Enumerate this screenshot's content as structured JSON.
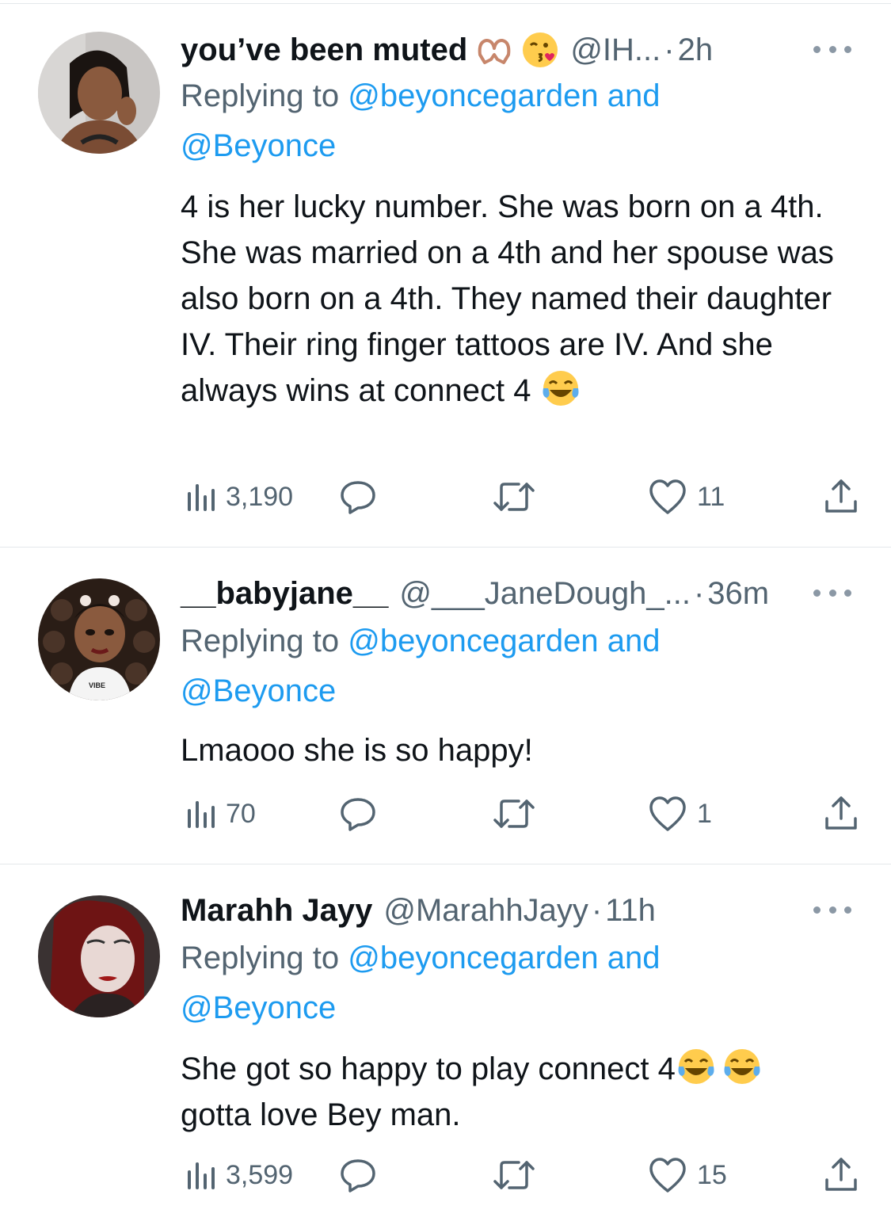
{
  "tweets": [
    {
      "name": "you’ve been muted",
      "name_emojis": [
        "heart-hands",
        "kissing-face"
      ],
      "handle": "@IH...",
      "dot": "·",
      "time": "2h",
      "reply_prefix": "Replying to",
      "reply_mention_1": "@beyoncegarden",
      "reply_and": "and",
      "reply_mention_2": "@Beyonce",
      "text": "4 is her lucky number. She was born on a 4th. She was married on a 4th and her spouse was also born on a 4th. They named their daughter IV. Their ring finger tattoos are IV. And she always wins at connect 4",
      "text_emoji": "tears-of-joy",
      "views": "3,190",
      "replies": "",
      "retweets": "",
      "likes": "11"
    },
    {
      "name": "__babyjane__",
      "handle": "@___JaneDough_...",
      "dot": "·",
      "time": "36m",
      "reply_prefix": "Replying to",
      "reply_mention_1": "@beyoncegarden",
      "reply_and": "and",
      "reply_mention_2": "@Beyonce",
      "text": "Lmaooo she is so happy!",
      "views": "70",
      "replies": "",
      "retweets": "",
      "likes": "1"
    },
    {
      "name": "Marahh Jayy",
      "handle": "@MarahhJayy",
      "dot": "·",
      "time": "11h",
      "reply_prefix": "Replying to",
      "reply_mention_1": "@beyoncegarden",
      "reply_and": "and",
      "reply_mention_2": "@Beyonce",
      "text_line1": "She got so happy to play connect 4",
      "text_line2": "gotta love Bey man.",
      "text_emojis": [
        "tears-of-joy",
        "tears-of-joy"
      ],
      "views": "3,599",
      "replies": "",
      "retweets": "",
      "likes": "15"
    }
  ],
  "colors": {
    "text": "#0f1419",
    "secondary": "#536471",
    "link": "#1d9bf0",
    "divider": "#e4e8eb"
  },
  "icons": [
    "views-icon",
    "reply-icon",
    "retweet-icon",
    "like-icon",
    "share-icon",
    "more-icon"
  ]
}
